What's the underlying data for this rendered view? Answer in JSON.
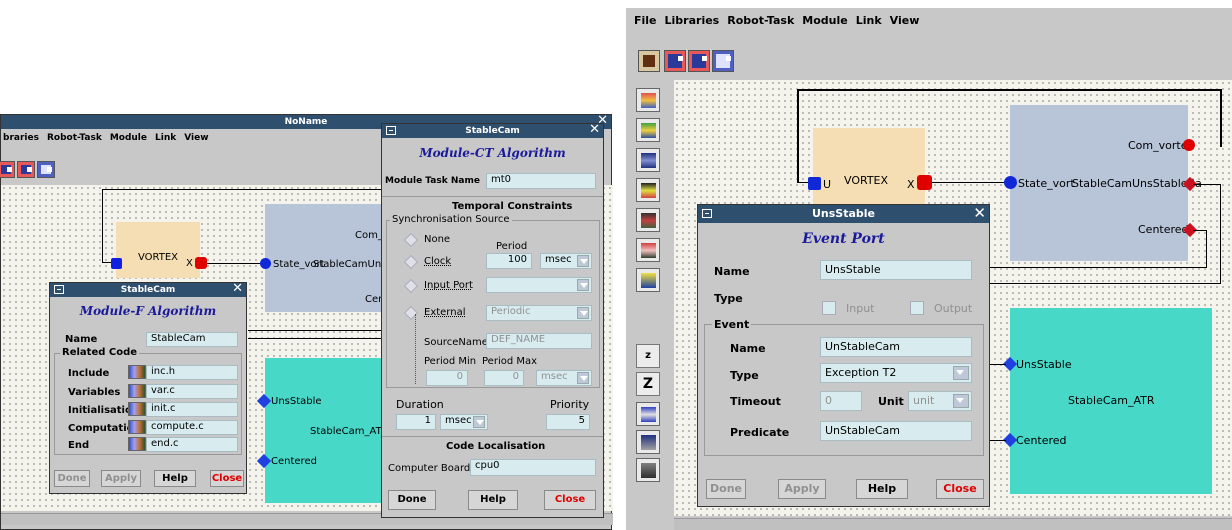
{
  "left_window": {
    "title": "NoName",
    "menu": [
      "braries",
      "Robot-Task",
      "Module",
      "Link",
      "View"
    ],
    "vortex": {
      "label": "VORTEX",
      "port_u": "U",
      "port_x": "X"
    },
    "stablecam_box": {
      "text1": "State_vort",
      "text2": "StableCamUnsStab",
      "text3": "Com_v",
      "text4": "Cen"
    },
    "atr_box": {
      "label": "StableCam_ATR",
      "port1": "UnsStable",
      "port2": "Centered"
    }
  },
  "dialog_f": {
    "title": "StableCam",
    "header": "Module-F Algorithm",
    "name_label": "Name",
    "name_value": "StableCam",
    "related_code": "Related Code",
    "rows": [
      {
        "label": "Include",
        "value": "inc.h"
      },
      {
        "label": "Variables",
        "value": "var.c"
      },
      {
        "label": "Initialisation",
        "value": "init.c"
      },
      {
        "label": "Computation",
        "value": "compute.c"
      },
      {
        "label": "End",
        "value": "end.c"
      }
    ],
    "buttons": {
      "done": "Done",
      "apply": "Apply",
      "help": "Help",
      "close": "Close"
    }
  },
  "dialog_ct": {
    "title": "StableCam",
    "header": "Module-CT Algorithm",
    "task_label": "Module Task Name",
    "task_value": "mt0",
    "temporal": "Temporal Constraints",
    "sync": "Synchronisation Source",
    "none": "None",
    "period": "Period",
    "clock": "Clock",
    "clock_value": "100",
    "clock_unit": "msec",
    "input_port": "Input Port",
    "external": "External",
    "periodic": "Periodic",
    "source_name": "SourceName",
    "source_value": "DEF_NAME",
    "period_min": "Period Min",
    "period_max": "Period Max",
    "pmin_value": "0",
    "pmax_value": "0",
    "pmax_unit": "msec",
    "duration": "Duration",
    "duration_value": "1",
    "duration_unit": "msec",
    "priority": "Priority",
    "priority_value": "5",
    "code_loc": "Code Localisation",
    "board_label": "Computer Board",
    "board_value": "cpu0",
    "buttons": {
      "done": "Done",
      "help": "Help",
      "close": "Close"
    }
  },
  "right_window": {
    "menu": [
      "File",
      "Libraries",
      "Robot-Task",
      "Module",
      "Link",
      "View"
    ],
    "zoom_in": "z",
    "zoom_out": "Z",
    "vortex": {
      "label": "VORTEX",
      "port_u": "U",
      "port_x": "X"
    },
    "stablecam_box": {
      "state": "State_vort",
      "mid": "StableCamUnsStableBa",
      "com": "Com_vorte",
      "centered": "Centered"
    },
    "atr_box": {
      "label": "StableCam_ATR",
      "port1": "UnsStable",
      "port2": "Centered"
    }
  },
  "dialog_ep": {
    "title": "UnsStable",
    "header": "Event Port",
    "name_label": "Name",
    "name_value": "UnsStable",
    "type_label": "Type",
    "input": "Input",
    "output": "Output",
    "event": "Event",
    "ev_name_label": "Name",
    "ev_name_value": "UnStableCam",
    "ev_type_label": "Type",
    "ev_type_value": "Exception T2",
    "timeout_label": "Timeout",
    "timeout_value": "0",
    "unit_label": "Unit",
    "unit_value": "unit",
    "predicate_label": "Predicate",
    "predicate_value": "UnStableCam",
    "buttons": {
      "done": "Done",
      "apply": "Apply",
      "help": "Help",
      "close": "Close"
    }
  }
}
